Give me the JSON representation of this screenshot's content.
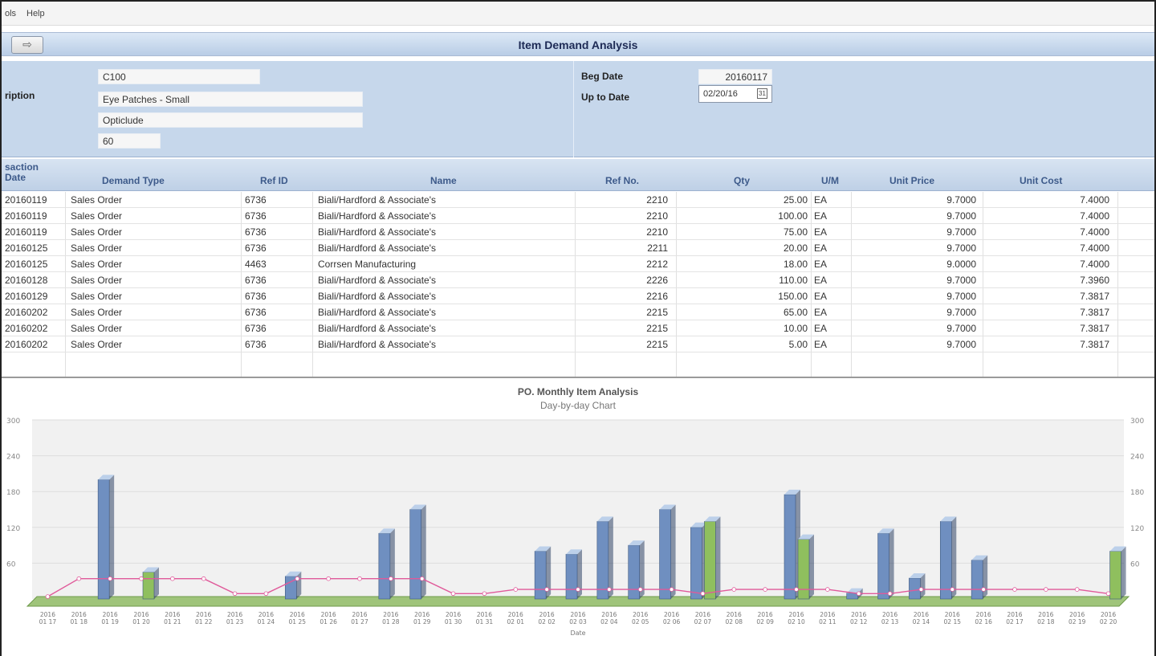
{
  "menu": [
    "ols",
    "Help"
  ],
  "title": "Item Demand Analysis",
  "back_icon": "arrow-right-icon",
  "header": {
    "description_label": "ription",
    "item_code": "C100",
    "description": "Eye Patches - Small",
    "brand": "Opticlude",
    "pack_qty": "60",
    "beg_date_label": "Beg Date",
    "beg_date": "20160117",
    "up_to_date_label": "Up to Date",
    "up_to_date": "02/20/16",
    "calendar_icon": "calendar-icon"
  },
  "grid": {
    "columns": [
      "saction\nDate",
      "Demand Type",
      "Ref ID",
      "Name",
      "Ref No.",
      "Qty",
      "U/M",
      "Unit Price",
      "Unit Cost"
    ],
    "rows": [
      [
        "20160119",
        "Sales Order",
        "6736",
        "Biali/Hardford & Associate's",
        "2210",
        "25.00",
        "EA",
        "9.7000",
        "7.4000"
      ],
      [
        "20160119",
        "Sales Order",
        "6736",
        "Biali/Hardford & Associate's",
        "2210",
        "100.00",
        "EA",
        "9.7000",
        "7.4000"
      ],
      [
        "20160119",
        "Sales Order",
        "6736",
        "Biali/Hardford & Associate's",
        "2210",
        "75.00",
        "EA",
        "9.7000",
        "7.4000"
      ],
      [
        "20160125",
        "Sales Order",
        "6736",
        "Biali/Hardford & Associate's",
        "2211",
        "20.00",
        "EA",
        "9.7000",
        "7.4000"
      ],
      [
        "20160125",
        "Sales Order",
        "4463",
        "Corrsen Manufacturing",
        "2212",
        "18.00",
        "EA",
        "9.0000",
        "7.4000"
      ],
      [
        "20160128",
        "Sales Order",
        "6736",
        "Biali/Hardford & Associate's",
        "2226",
        "110.00",
        "EA",
        "9.7000",
        "7.3960"
      ],
      [
        "20160129",
        "Sales Order",
        "6736",
        "Biali/Hardford & Associate's",
        "2216",
        "150.00",
        "EA",
        "9.7000",
        "7.3817"
      ],
      [
        "20160202",
        "Sales Order",
        "6736",
        "Biali/Hardford & Associate's",
        "2215",
        "65.00",
        "EA",
        "9.7000",
        "7.3817"
      ],
      [
        "20160202",
        "Sales Order",
        "6736",
        "Biali/Hardford & Associate's",
        "2215",
        "10.00",
        "EA",
        "9.7000",
        "7.3817"
      ],
      [
        "20160202",
        "Sales Order",
        "6736",
        "Biali/Hardford & Associate's",
        "2215",
        "5.00",
        "EA",
        "9.7000",
        "7.3817"
      ]
    ]
  },
  "chart_data": {
    "type": "bar",
    "title": "PO. Monthly Item Analysis",
    "subtitle": "Day-by-day Chart",
    "xlabel": "Date",
    "ylabel": "",
    "ylim": [
      0,
      300
    ],
    "yticks": [
      "300",
      "240",
      "180",
      "120",
      "60"
    ],
    "categories": [
      "2016 01 17",
      "2016 01 18",
      "2016 01 19",
      "2016 01 20",
      "2016 01 21",
      "2016 01 22",
      "2016 01 23",
      "2016 01 24",
      "2016 01 25",
      "2016 01 26",
      "2016 01 27",
      "2016 01 28",
      "2016 01 29",
      "2016 01 30",
      "2016 01 31",
      "2016 02 01",
      "2016 02 02",
      "2016 02 03",
      "2016 02 04",
      "2016 02 05",
      "2016 02 06",
      "2016 02 07",
      "2016 02 08",
      "2016 02 09",
      "2016 02 10",
      "2016 02 11",
      "2016 02 12",
      "2016 02 13",
      "2016 02 14",
      "2016 02 15",
      "2016 02 16",
      "2016 02 17",
      "2016 02 18",
      "2016 02 19",
      "2016 02 20"
    ],
    "series": [
      {
        "values": [
          0,
          0,
          200,
          0,
          0,
          0,
          0,
          0,
          38,
          0,
          0,
          110,
          150,
          0,
          0,
          0,
          80,
          75,
          130,
          90,
          150,
          120,
          0,
          0,
          175,
          0,
          10,
          110,
          35,
          130,
          65,
          0,
          0,
          0,
          0
        ],
        "color": "#6f8fc0"
      },
      {
        "values": [
          0,
          0,
          0,
          45,
          0,
          0,
          0,
          0,
          0,
          0,
          0,
          0,
          0,
          0,
          0,
          0,
          0,
          0,
          0,
          0,
          0,
          130,
          0,
          0,
          100,
          0,
          0,
          0,
          0,
          0,
          0,
          0,
          0,
          0,
          80
        ],
        "color": "#8fbf5e"
      },
      {
        "values": [
          0,
          30,
          30,
          30,
          30,
          30,
          5,
          5,
          30,
          30,
          30,
          30,
          30,
          5,
          5,
          12,
          12,
          12,
          12,
          12,
          12,
          5,
          12,
          12,
          12,
          12,
          5,
          5,
          12,
          12,
          12,
          12,
          12,
          12,
          5
        ],
        "color": "#e05a9a",
        "type": "line"
      }
    ]
  }
}
